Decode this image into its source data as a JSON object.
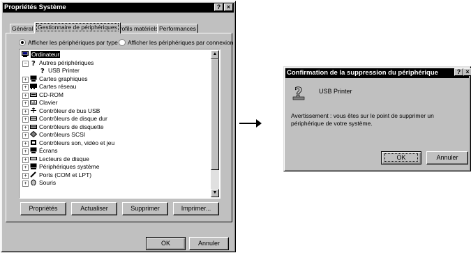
{
  "main_window": {
    "title": "Propriétés Système",
    "help_glyph": "?",
    "close_glyph": "×",
    "tabs": [
      {
        "label": "Général"
      },
      {
        "label": "Gestionnaire de périphériques"
      },
      {
        "label": "Profils matériels"
      },
      {
        "label": "Performances"
      }
    ],
    "radio_by_type": "Afficher les périphériques par type",
    "radio_by_connection": "Afficher les périphériques par connexion",
    "tree": [
      {
        "label": "Ordinateur",
        "icon": "computer-icon"
      },
      {
        "label": "Autres périphériques",
        "icon": "unknown-device-icon"
      },
      {
        "label": "USB Printer",
        "icon": "unknown-device-icon"
      },
      {
        "label": "Cartes graphiques",
        "icon": "display-adapter-icon"
      },
      {
        "label": "Cartes réseau",
        "icon": "network-card-icon"
      },
      {
        "label": "CD-ROM",
        "icon": "cdrom-icon"
      },
      {
        "label": "Clavier",
        "icon": "keyboard-icon"
      },
      {
        "label": "Contrôleur de bus USB",
        "icon": "usb-icon"
      },
      {
        "label": "Contrôleurs de disque dur",
        "icon": "disk-controller-icon"
      },
      {
        "label": "Contrôleurs de disquette",
        "icon": "floppy-controller-icon"
      },
      {
        "label": "Contrôleurs SCSI",
        "icon": "scsi-icon"
      },
      {
        "label": "Contrôleurs son, vidéo et jeu",
        "icon": "sound-icon"
      },
      {
        "label": "Écrans",
        "icon": "monitor-icon"
      },
      {
        "label": "Lecteurs de disque",
        "icon": "disk-drive-icon"
      },
      {
        "label": "Périphériques système",
        "icon": "system-device-icon"
      },
      {
        "label": "Ports (COM et LPT)",
        "icon": "port-icon"
      },
      {
        "label": "Souris",
        "icon": "mouse-icon"
      }
    ],
    "buttons": {
      "properties": "Propriétés",
      "refresh": "Actualiser",
      "remove": "Supprimer",
      "print": "Imprimer...",
      "ok": "OK",
      "cancel": "Annuler"
    }
  },
  "dialog": {
    "title": "Confirmation de la suppression du périphérique",
    "help_glyph": "?",
    "close_glyph": "×",
    "device_name": "USB Printer",
    "warning_line1": "Avertissement : vous êtes sur le point de supprimer un",
    "warning_line2": "périphérique de votre système.",
    "ok": "OK",
    "cancel": "Annuler"
  }
}
